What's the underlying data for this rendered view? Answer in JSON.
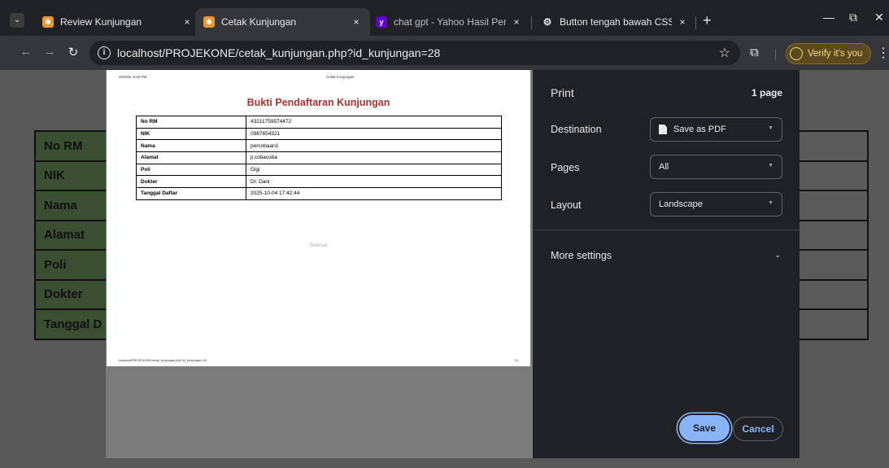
{
  "tabs": [
    {
      "title": "Review Kunjungan",
      "favicon_color": "#e9962e",
      "active": false
    },
    {
      "title": "Cetak Kunjungan",
      "favicon_color": "#e9962e",
      "active": true
    },
    {
      "title": "chat gpt - Yahoo Hasil Pencarian",
      "favicon_color": "#6001d2",
      "active": false
    },
    {
      "title": "Button tengah bawah CSS",
      "favicon_color": "#e8eaed",
      "active": false
    }
  ],
  "tab_icons": {
    "close": "×",
    "new_tab": "+",
    "menu": "⌄"
  },
  "window_controls": {
    "minimize": "—",
    "restore": "⧉",
    "close": "✕"
  },
  "toolbar": {
    "url": "localhost/PROJEKONE/cetak_kunjungan.php?id_kunjungan=28",
    "verify_label": "Verify it's you",
    "back": "←",
    "forward": "→",
    "reload": "↻",
    "star": "☆",
    "extension": "⧉",
    "menu": "⋮"
  },
  "background_page": {
    "labels": [
      "No RM",
      "NIK",
      "Nama",
      "Alamat",
      "Poli",
      "Dokter",
      "Tanggal D"
    ]
  },
  "preview": {
    "header_date": "10/4/25, 5:42 PM",
    "header_title": "Cetak Kunjungan",
    "title": "Bukti Pendaftaran Kunjungan",
    "rows": [
      {
        "key": "No RM",
        "value": "43211759574472"
      },
      {
        "key": "NIK",
        "value": "0987654321"
      },
      {
        "key": "Nama",
        "value": "percobaan1"
      },
      {
        "key": "Alamat",
        "value": "jl.cobacoba"
      },
      {
        "key": "Poli",
        "value": "Gigi"
      },
      {
        "key": "Dokter",
        "value": "Dr. Dani"
      },
      {
        "key": "Tanggal Daftar",
        "value": "2025-10-04 17:42:44"
      }
    ],
    "status_text": "Selesai",
    "footer_url": "localhost/PROJEKONE/cetak_kunjungan.php?id_kunjungan=28",
    "footer_page": "1/1"
  },
  "print_panel": {
    "title": "Print",
    "page_count": "1 page",
    "destination_label": "Destination",
    "destination_value": "Save as PDF",
    "pages_label": "Pages",
    "pages_value": "All",
    "layout_label": "Layout",
    "layout_value": "Landscape",
    "more_settings": "More settings",
    "save": "Save",
    "cancel": "Cancel"
  },
  "colors": {
    "accent": "#8ab4f8",
    "title_red": "#b03030",
    "verify_bg": "#5a4a1e"
  }
}
